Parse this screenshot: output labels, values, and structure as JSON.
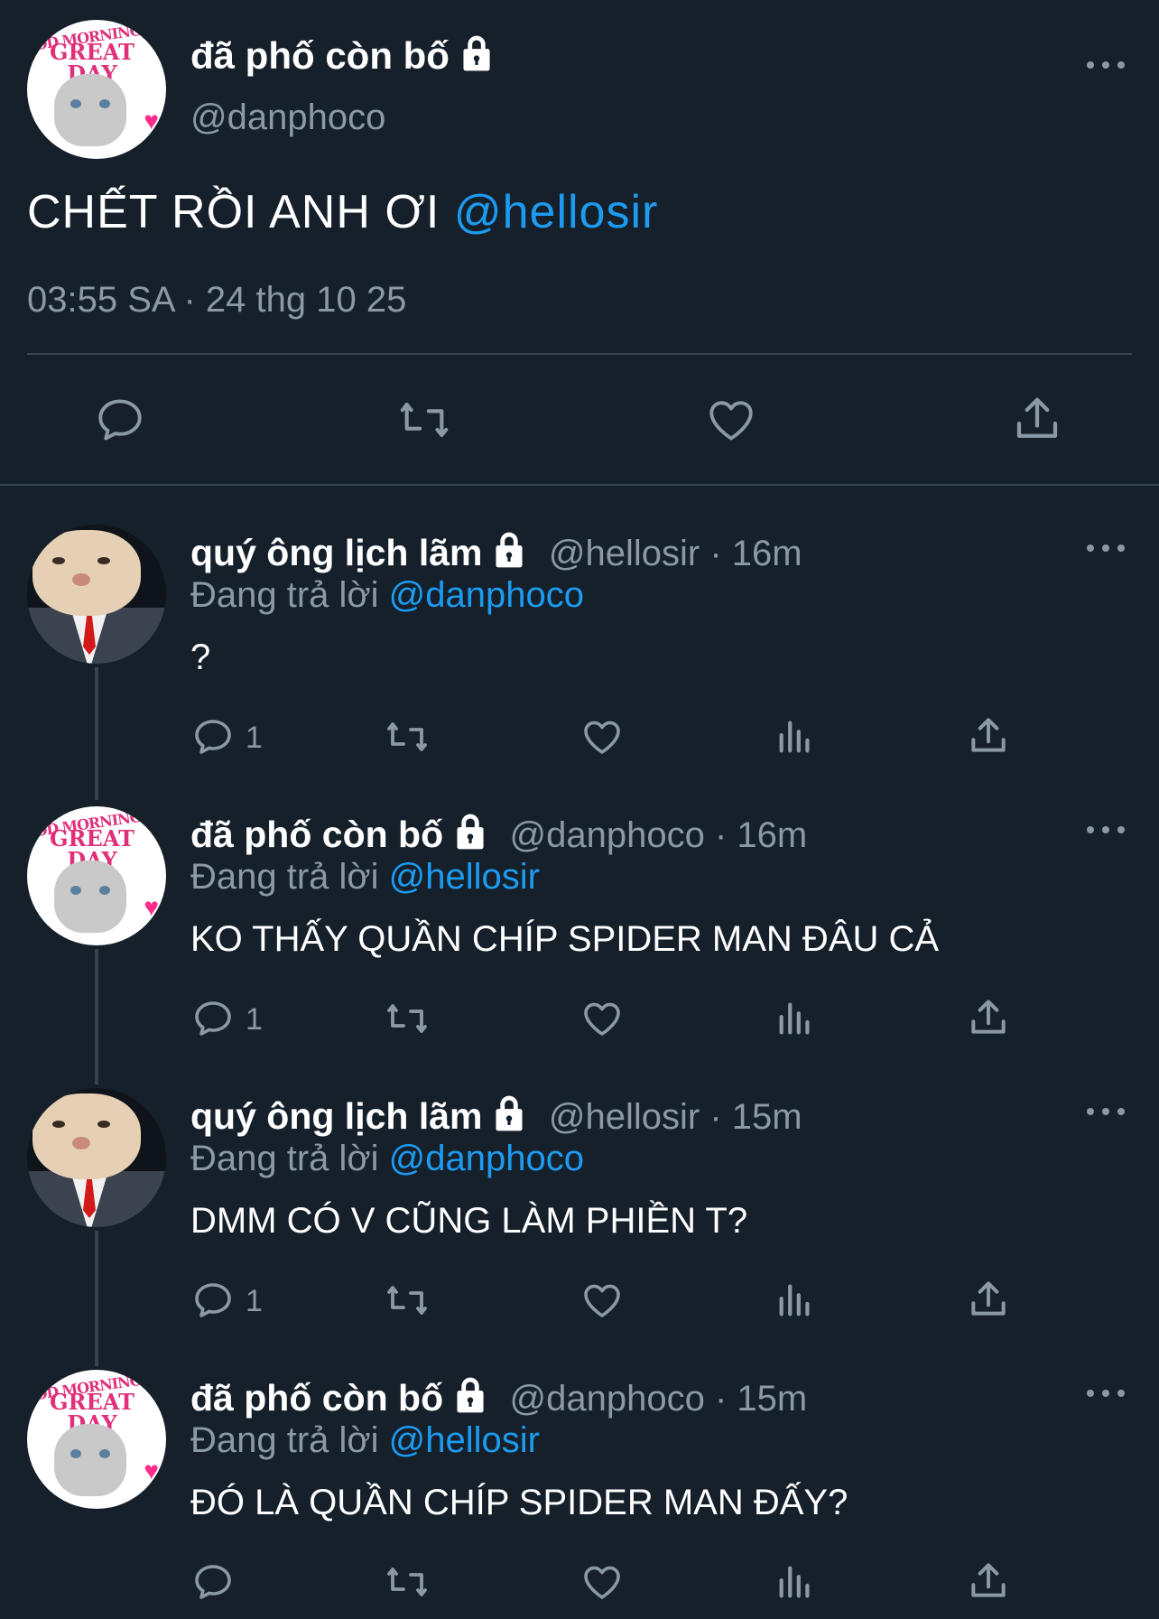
{
  "main_tweet": {
    "name": "đã phố còn bố",
    "handle": "@danphoco",
    "text": "CHẾT RỒI ANH ƠI ",
    "mention": "@hellosir",
    "timestamp": "03:55 SA · 24 thg 10 25",
    "avatar_text_1": "OD MORNING",
    "avatar_text_2": "GREAT DAY"
  },
  "replies": [
    {
      "name": "quý ông lịch lãm",
      "handle_time": "@hellosir · 16m",
      "replying_prefix": "Đang trả lời ",
      "replying_to": "@danphoco",
      "text": "?",
      "reply_count": "1"
    },
    {
      "name": "đã phố còn bố",
      "handle_time": "@danphoco · 16m",
      "replying_prefix": "Đang trả lời ",
      "replying_to": "@hellosir",
      "text": "KO THẤY QUẦN CHÍP SPIDER MAN ĐÂU CẢ",
      "reply_count": "1"
    },
    {
      "name": "quý ông lịch lãm",
      "handle_time": "@hellosir · 15m",
      "replying_prefix": "Đang trả lời ",
      "replying_to": "@danphoco",
      "text": "DMM CÓ V CŨNG LÀM PHIỀN T?",
      "reply_count": "1"
    },
    {
      "name": "đã phố còn bố",
      "handle_time": "@danphoco · 15m",
      "replying_prefix": "Đang trả lời ",
      "replying_to": "@hellosir",
      "text": "ĐÓ LÀ QUẦN CHÍP SPIDER MAN ĐẤY?",
      "reply_count": ""
    }
  ],
  "icons": {
    "reply": "reply-icon",
    "retweet": "retweet-icon",
    "like": "like-icon",
    "views": "views-icon",
    "share": "share-icon",
    "more": "more-icon",
    "lock": "lock-icon"
  },
  "colors": {
    "background": "#15202b",
    "accent": "#1d9bf0",
    "secondary_text": "#8b98a5",
    "divider": "#38444d"
  }
}
